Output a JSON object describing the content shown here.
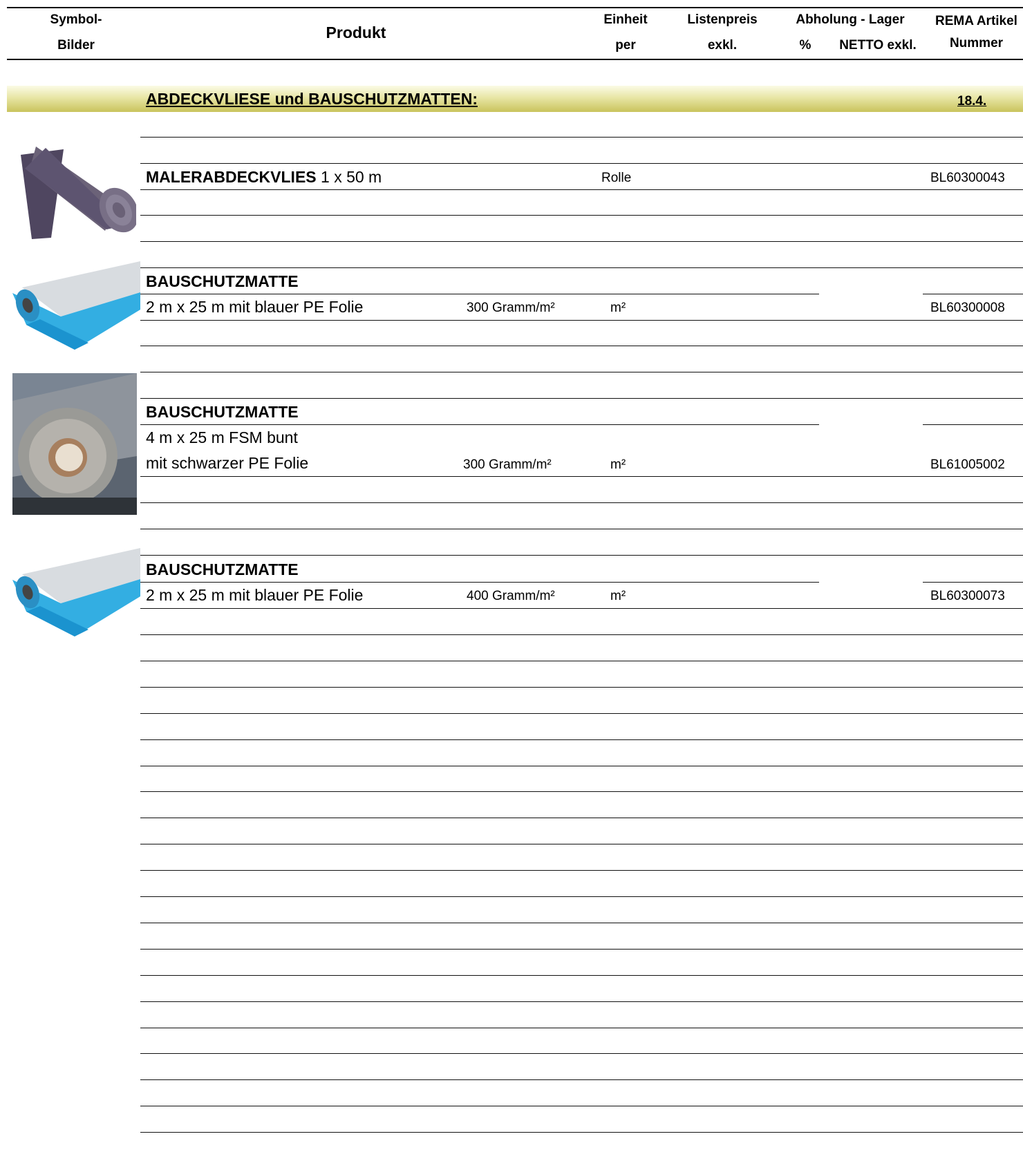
{
  "header": {
    "col_symbol_1": "Symbol-",
    "col_symbol_2": "Bilder",
    "col_product": "Produkt",
    "col_unit_1": "Einheit",
    "col_unit_2": "per",
    "col_list_1": "Listenpreis",
    "col_list_2": "exkl.",
    "col_pickup_1": "Abholung - Lager",
    "col_pickup_pct": "%",
    "col_pickup_net": "NETTO exkl.",
    "col_rema_1": "REMA Artikel",
    "col_rema_2": "Nummer"
  },
  "section": {
    "title": "ABDECKVLIESE und BAUSCHUTZMATTEN:",
    "number": "18.4."
  },
  "products": [
    {
      "name_bold": "MALERABDECKVLIES",
      "name_rest": " 1 x 50 m",
      "unit": "Rolle",
      "article": "BL60300043",
      "image": "grey-fleece-roll"
    },
    {
      "name_bold": "BAUSCHUTZMATTE",
      "line2": "2 m   x   25 m  mit blauer  PE Folie",
      "weight": "300 Gramm/m²",
      "unit": "m²",
      "article": "BL60300008",
      "image": "blue-mat-roll"
    },
    {
      "name_bold": "BAUSCHUTZMATTE",
      "line2": "4 m   x   25 m  FSM bunt",
      "line3": "mit schwarzer PE Folie",
      "weight": "300 Gramm/m²",
      "unit": "m²",
      "article": "BL61005002",
      "image": "grey-mat-roll-photo"
    },
    {
      "name_bold": "BAUSCHUTZMATTE",
      "line2": "2 m   x   25 m  mit blauer  PE Folie",
      "weight": "400 Gramm/m²",
      "unit": "m²",
      "article": "BL60300073",
      "image": "blue-mat-roll"
    }
  ]
}
